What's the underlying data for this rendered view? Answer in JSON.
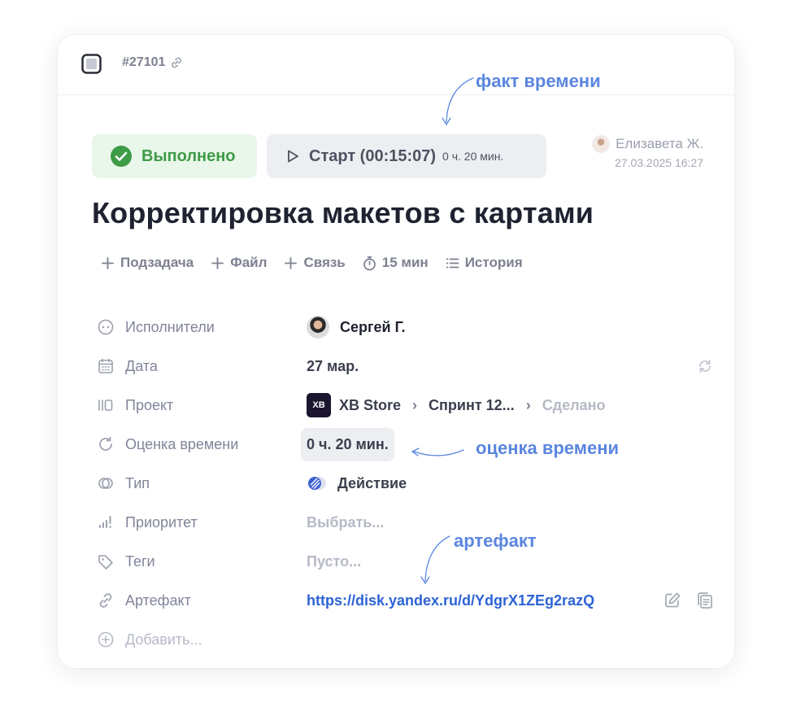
{
  "task": {
    "id": "#27101",
    "title": "Корректировка макетов с картами"
  },
  "status_button": {
    "label": "Выполнено"
  },
  "timer_button": {
    "label": "Старт (00:15:07)",
    "sublabel": "0 ч. 20 мин."
  },
  "author": {
    "name": "Елизавета Ж.",
    "date": "27.03.2025 16:27"
  },
  "actions": {
    "subtask": "Подзадача",
    "file": "Файл",
    "link": "Связь",
    "timer": "15 мин",
    "history": "История"
  },
  "props": {
    "assignees": {
      "label": "Исполнители",
      "value": "Сергей Г."
    },
    "date": {
      "label": "Дата",
      "value": "27 мар."
    },
    "project": {
      "label": "Проект",
      "logo": "XB",
      "project": "XB Store",
      "sprint": "Спринт 12...",
      "stage": "Сделано"
    },
    "estimate": {
      "label": "Оценка времени",
      "value": "0 ч. 20 мин."
    },
    "type": {
      "label": "Тип",
      "value": "Действие"
    },
    "priority": {
      "label": "Приоритет",
      "value": "Выбрать..."
    },
    "tags": {
      "label": "Теги",
      "value": "Пусто..."
    },
    "artifact": {
      "label": "Артефакт",
      "value": "https://disk.yandex.ru/d/YdgrX1ZEg2razQ"
    },
    "add": {
      "label": "Добавить..."
    }
  },
  "annotations": {
    "time_fact": "факт времени",
    "time_estimate": "оценка времени",
    "artifact": "артефакт"
  },
  "colors": {
    "accent_blue": "#2d63d6",
    "annotation_blue": "#5b86e0",
    "done_green": "#3e9b46",
    "done_bg": "#e9f6ea"
  },
  "icons": {
    "square": "square-icon",
    "link": "link-icon",
    "check": "check-circle-icon",
    "play": "play-icon",
    "plus": "plus-icon",
    "stopwatch": "stopwatch-icon",
    "list": "list-icon",
    "face": "face-icon",
    "calendar": "calendar-icon",
    "repeat": "repeat-icon",
    "columns": "columns-icon",
    "refresh": "refresh-icon",
    "type": "type-icon",
    "bars": "priority-bars-icon",
    "tag": "tag-icon",
    "chain": "chain-icon",
    "edit": "edit-icon",
    "copy": "copy-icon",
    "add": "add-circle-icon"
  }
}
